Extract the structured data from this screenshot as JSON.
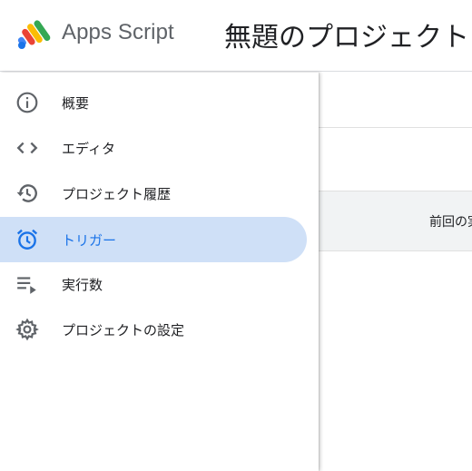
{
  "header": {
    "app_name": "Apps Script",
    "project_title": "無題のプロジェクト"
  },
  "main": {
    "column_header": "前回の実"
  },
  "sidebar": {
    "items": [
      {
        "label": "概要",
        "icon": "info-icon",
        "active": false
      },
      {
        "label": "エディタ",
        "icon": "code-icon",
        "active": false
      },
      {
        "label": "プロジェクト履歴",
        "icon": "history-icon",
        "active": false
      },
      {
        "label": "トリガー",
        "icon": "alarm-icon",
        "active": true
      },
      {
        "label": "実行数",
        "icon": "playlist-play-icon",
        "active": false
      },
      {
        "label": "プロジェクトの設定",
        "icon": "gear-icon",
        "active": false
      }
    ]
  },
  "colors": {
    "active_bg": "#cfe0f7",
    "active_text": "#1a73e8",
    "icon_gray": "#5f6368"
  }
}
